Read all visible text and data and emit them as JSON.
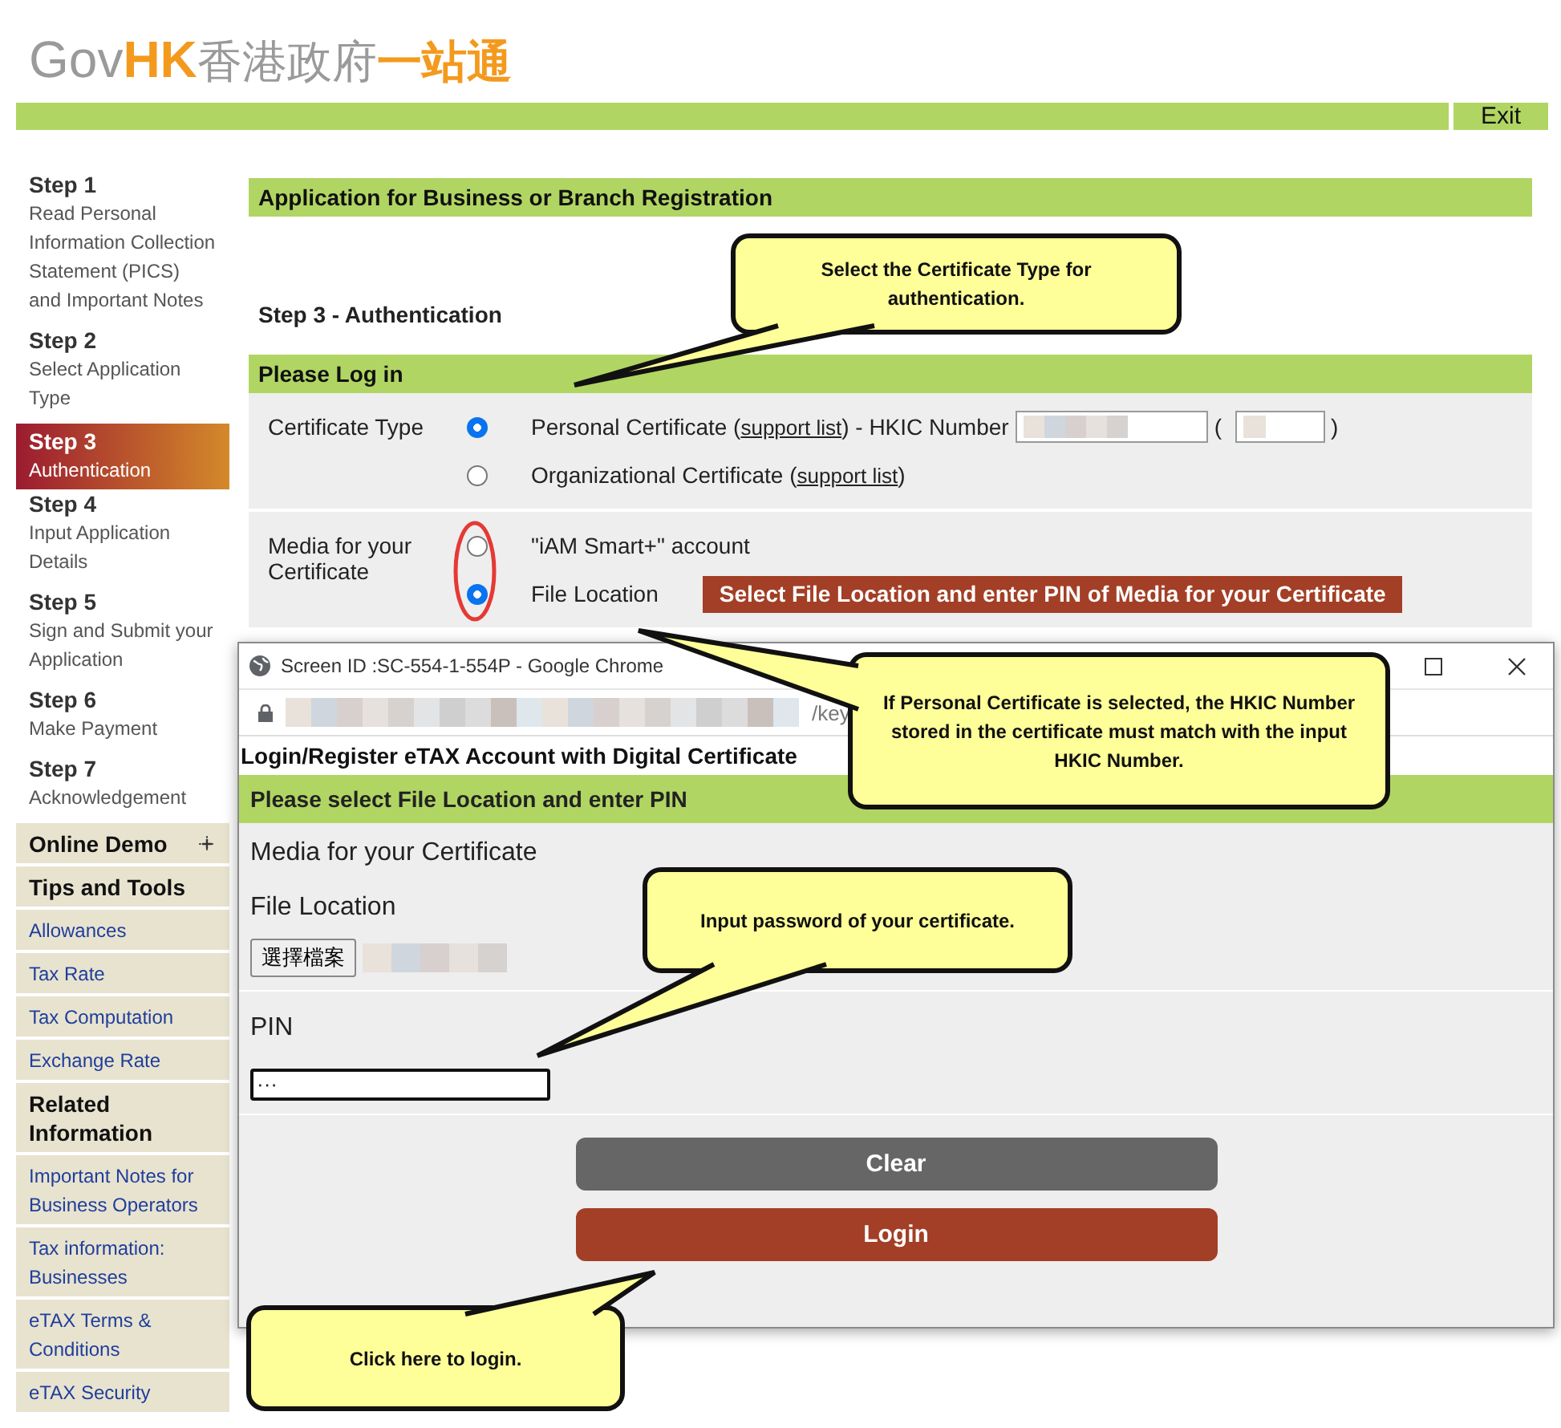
{
  "header": {
    "logo_parts": [
      {
        "text": "Gov",
        "kind": "plain"
      },
      {
        "text": "HK",
        "kind": "accent"
      },
      {
        "text": "香港政府",
        "kind": "plain"
      },
      {
        "text": "一站通",
        "kind": "accent"
      }
    ],
    "exit": "Exit"
  },
  "steps": [
    {
      "number": "Step 1",
      "label": "Read Personal Information Collection Statement (PICS) and Important Notes",
      "selected": false
    },
    {
      "number": "Step 2",
      "label": "Select Application Type",
      "selected": false
    },
    {
      "number": "Step 3",
      "label": "Authentication",
      "selected": true
    },
    {
      "number": "Step 4",
      "label": "Input Application Details",
      "selected": false
    },
    {
      "number": "Step 5",
      "label": "Sign and Submit your Application",
      "selected": false
    },
    {
      "number": "Step 6",
      "label": "Make Payment",
      "selected": false
    },
    {
      "number": "Step 7",
      "label": "Acknowledgement",
      "selected": false
    }
  ],
  "sidebar_links": [
    {
      "label": "Online Demo",
      "kind": "demo"
    },
    {
      "label": "Tips and Tools",
      "kind": "heading"
    },
    {
      "label": "Allowances",
      "kind": "link"
    },
    {
      "label": "Tax Rate",
      "kind": "link"
    },
    {
      "label": "Tax Computation",
      "kind": "link"
    },
    {
      "label": "Exchange Rate",
      "kind": "link"
    },
    {
      "label": "Related Information",
      "kind": "heading"
    },
    {
      "label": "Important Notes for Business Operators",
      "kind": "link"
    },
    {
      "label": "Tax information: Businesses",
      "kind": "link"
    },
    {
      "label": "eTAX Terms & Conditions",
      "kind": "link"
    },
    {
      "label": "eTAX Security",
      "kind": "link"
    }
  ],
  "page": {
    "title": "Application for Business or Branch Registration",
    "step_heading": "Step 3 - Authentication",
    "section": "Please Log in",
    "certificate_type": {
      "label": "Certificate Type",
      "options": [
        {
          "before": "Personal Certificate (",
          "link": "support list",
          "after": ") - HKIC Number",
          "selected": true,
          "hkic": {
            "open": "(",
            "close": ")"
          }
        },
        {
          "before": "Organizational Certificate (",
          "link": "support list",
          "after": ")",
          "selected": false
        }
      ]
    },
    "media": {
      "label": "Media for your Certificate",
      "options": [
        {
          "label": "\"iAM Smart+\" account",
          "selected": false
        },
        {
          "label": "File Location",
          "selected": true
        }
      ],
      "hint": "Select File Location and enter PIN of Media for your Certificate"
    }
  },
  "popup": {
    "title": "Screen ID :SC-554-1-554P - Google Chrome",
    "url_tail": "/key",
    "heading": "Login/Register eTAX Account with Digital Certificate",
    "section": "Please select File Location and enter PIN",
    "media_label": "Media for your Certificate",
    "file_label": "File Location",
    "file_button": "選擇檔案",
    "pin_label": "PIN",
    "pin_value": "···",
    "buttons": [
      {
        "label": "Clear",
        "kind": "secondary"
      },
      {
        "label": "Login",
        "kind": "primary"
      }
    ]
  },
  "callouts": [
    {
      "text": "Select the Certificate Type for authentication."
    },
    {
      "text": "If Personal Certificate is selected, the HKIC Number stored in the certificate must match with the input HKIC Number."
    },
    {
      "text": "Input password of your certificate."
    },
    {
      "text": "Click here to login."
    }
  ]
}
